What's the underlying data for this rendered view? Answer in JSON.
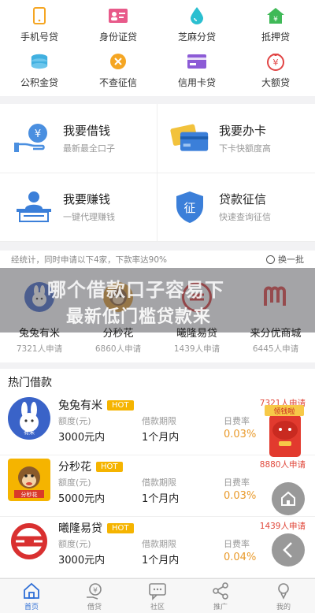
{
  "grid": [
    {
      "label": "手机号贷",
      "icon": "phone-icon",
      "color": "#f5a623"
    },
    {
      "label": "身份证贷",
      "icon": "id-card-icon",
      "color": "#e85a8a"
    },
    {
      "label": "芝麻分贷",
      "icon": "drop-icon",
      "color": "#2bbfd0"
    },
    {
      "label": "抵押贷",
      "icon": "house-icon",
      "color": "#3fb957"
    },
    {
      "label": "公积金贷",
      "icon": "coins-icon",
      "color": "#41b0e0"
    },
    {
      "label": "不查征信",
      "icon": "close-circle-icon",
      "color": "#f5a623"
    },
    {
      "label": "信用卡贷",
      "icon": "credit-card-icon",
      "color": "#8c5bd6"
    },
    {
      "label": "大额贷",
      "icon": "money-bag-icon",
      "color": "#e14444"
    }
  ],
  "cards": [
    {
      "title": "我要借钱",
      "sub": "最新最全口子",
      "icon": "hand-coin-icon"
    },
    {
      "title": "我要办卡",
      "sub": "下卡快额度高",
      "icon": "cards-icon"
    },
    {
      "title": "我要赚钱",
      "sub": "一键代理赚钱",
      "icon": "agent-icon"
    },
    {
      "title": "贷款征信",
      "sub": "快速查询征信",
      "icon": "shield-zheng-icon"
    }
  ],
  "stats": {
    "text": "经统计，同时申请以下4家，下款率达90%",
    "refresh": "换一批",
    "banner_line1": "哪个借款口子容易下",
    "banner_line2": "最新低门槛贷款来",
    "apps": [
      {
        "name": "兔兔有米",
        "count": "7321人申请",
        "logo": "rabbit-logo-icon",
        "color": "#3a63c8"
      },
      {
        "name": "分秒花",
        "count": "6860人申请",
        "logo": "monkey-logo-icon",
        "color": "#e09a2b"
      },
      {
        "name": "曦隆易贷",
        "count": "1439人申请",
        "logo": "xilong-logo-icon",
        "color": "#d93030"
      },
      {
        "name": "来分优商城",
        "count": "6445人申请",
        "logo": "laifen-logo-icon",
        "color": "#e03a3a"
      }
    ]
  },
  "hot": {
    "title": "热门借款",
    "badge": "HOT",
    "col_amount": "额度(元)",
    "col_term": "借款期限",
    "col_rate": "日费率",
    "loans": [
      {
        "name": "兔兔有米",
        "count": "7321人申请",
        "amount": "3000元内",
        "term": "1个月内",
        "rate": "0.03%"
      },
      {
        "name": "分秒花",
        "count": "8880人申请",
        "amount": "5000元内",
        "term": "1个月内",
        "rate": "0.03%"
      },
      {
        "name": "曦隆易贷",
        "count": "1439人申请",
        "amount": "3000元内",
        "term": "1个月内",
        "rate": "0.04%"
      }
    ]
  },
  "logo_texts": {
    "rabbit": "有米",
    "monkey": "分秒花"
  },
  "red_pack": "领钱啦",
  "tabs": [
    {
      "label": "首页",
      "icon": "home-icon",
      "active": true
    },
    {
      "label": "借贷",
      "icon": "loan-icon",
      "active": false
    },
    {
      "label": "社区",
      "icon": "chat-icon",
      "active": false
    },
    {
      "label": "推广",
      "icon": "share-icon",
      "active": false
    },
    {
      "label": "我的",
      "icon": "user-icon",
      "active": false
    }
  ]
}
